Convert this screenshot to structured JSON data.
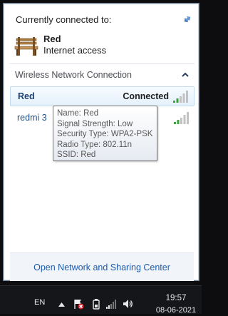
{
  "flyout": {
    "header": "Currently connected to:",
    "current_network": {
      "name": "Red",
      "status": "Internet access",
      "icon": "bench-icon"
    },
    "refresh_icon": "refresh-arrows-icon",
    "group": {
      "title": "Wireless Network Connection",
      "icon": "chevron-up-icon"
    },
    "networks": [
      {
        "name": "Red",
        "status": "Connected",
        "signal_bars": 5,
        "signal_strength_level": 2
      },
      {
        "name": "redmi 3",
        "status": "",
        "signal_bars": 5,
        "signal_strength_level": 2
      }
    ],
    "tooltip": [
      "Name: Red",
      "Signal Strength: Low",
      "Security Type: WPA2-PSK",
      "Radio Type: 802.11n",
      "SSID: Red"
    ],
    "open_center_label": "Open Network and Sharing Center"
  },
  "taskbar": {
    "language": "EN",
    "time": "19:57",
    "date": "08-06-2021",
    "tray_icons": [
      "tray-expand-icon",
      "action-center-icon",
      "battery-icon",
      "wifi-signal-icon",
      "speaker-icon"
    ]
  },
  "colors": {
    "link": "#1f5aa8",
    "network_name": "#1d4f86",
    "selected_row_border": "#c3dbef",
    "taskbar": "#151619",
    "signal_active": "#3ca23c",
    "signal_inactive": "#c2c2c2"
  }
}
